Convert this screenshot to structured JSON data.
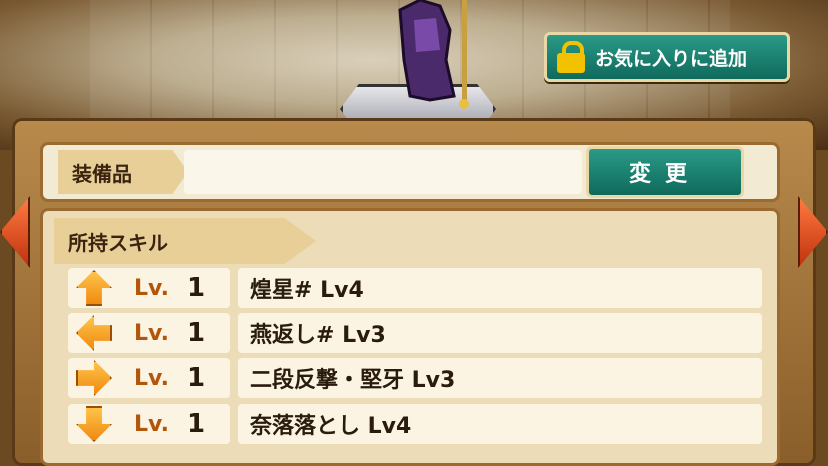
{
  "favorite_button": {
    "label": "お気に入りに追加",
    "icon": "lock-icon"
  },
  "equipment": {
    "tag_label": "装備品",
    "value": "",
    "change_label": "変更"
  },
  "skills": {
    "tag_label": "所持スキル",
    "rows": [
      {
        "direction": "up",
        "icon": "arrow-up-icon",
        "lv_label": "Lv.",
        "lv_value": "1",
        "name": "煌星# Lv4"
      },
      {
        "direction": "left",
        "icon": "arrow-left-icon",
        "lv_label": "Lv.",
        "lv_value": "1",
        "name": "燕返し# Lv3"
      },
      {
        "direction": "right",
        "icon": "arrow-right-icon",
        "lv_label": "Lv.",
        "lv_value": "1",
        "name": "二段反撃・堅牙 Lv3"
      },
      {
        "direction": "down",
        "icon": "arrow-down-icon",
        "lv_label": "Lv.",
        "lv_value": "1",
        "name": "奈落落とし Lv4"
      }
    ]
  },
  "nav": {
    "prev_icon": "arrow-left-nav-icon",
    "next_icon": "arrow-right-nav-icon"
  },
  "colors": {
    "button_teal": "#0f6a5c",
    "panel": "#ecdcb8",
    "accent_orange": "#f08a10"
  }
}
